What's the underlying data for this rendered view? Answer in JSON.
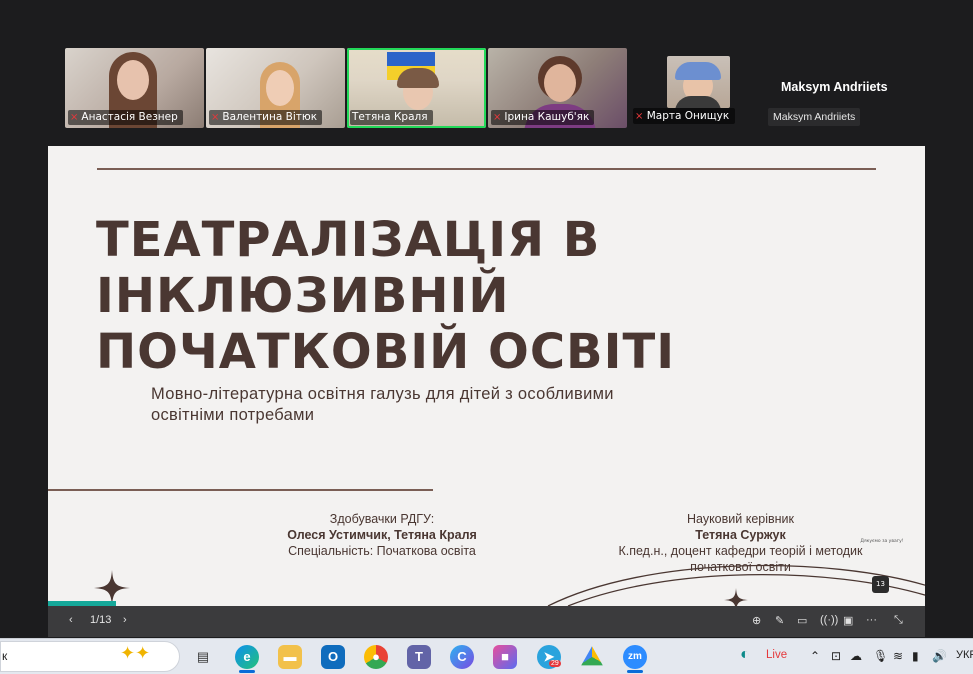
{
  "participants": [
    {
      "name": "Анастасія Везнер",
      "muted": true
    },
    {
      "name": "Валентина Вітюк",
      "muted": true
    },
    {
      "name": "Тетяна Краля",
      "muted": false,
      "speaking": true
    },
    {
      "name": "Ірина Кашуб'як",
      "muted": true
    },
    {
      "name": "Марта Онищук",
      "muted": true
    },
    {
      "name": "Maksym Andriiets",
      "muted": false
    }
  ],
  "mute_icon": "mic-muted-icon",
  "slide": {
    "title_lines": [
      "ТЕАТРАЛІЗАЦІЯ В",
      "ІНКЛЮЗИВНІЙ",
      "ПОЧАТКОВІЙ ОСВІТІ"
    ],
    "subtitle_lines": [
      "Мовно-літературна освітня галузь для дітей з особливими",
      "освітніми потребами"
    ],
    "left_block": {
      "label": "Здобувачки РДГУ:",
      "names": "Олеся Устимчик, Тетяна Краля",
      "specialty": "Спеціальність: Початкова освіта"
    },
    "right_block": {
      "label": "Науковий керівник",
      "name": "Тетяна Суржук",
      "position_lines": [
        "К.пед.н., доцент кафедри теорій і методик",
        "початкової освіти"
      ]
    },
    "thumbnail_text": "Дякуємо за увагу!",
    "thumbnail_badge": "13",
    "colors": {
      "text": "#4a3732",
      "background": "#f3f2f1",
      "accent": "#15a89a"
    }
  },
  "controls": {
    "page": "1/13",
    "prev_icon": "chevron-left-icon",
    "next_icon": "chevron-right-icon",
    "tools": [
      "zoom-icon",
      "pen-icon",
      "subtitles-icon",
      "broadcast-icon",
      "slides-icon",
      "more-icon",
      "collapse-icon"
    ]
  },
  "taskbar": {
    "search_text": "к",
    "apps": [
      "task-view",
      "edge",
      "file-explorer",
      "outlook",
      "chrome",
      "teams",
      "copilot",
      "ms365",
      "telegram",
      "google-drive",
      "zoom"
    ],
    "telegram_badge": "29",
    "live_label": "Live",
    "language": "УКР"
  }
}
